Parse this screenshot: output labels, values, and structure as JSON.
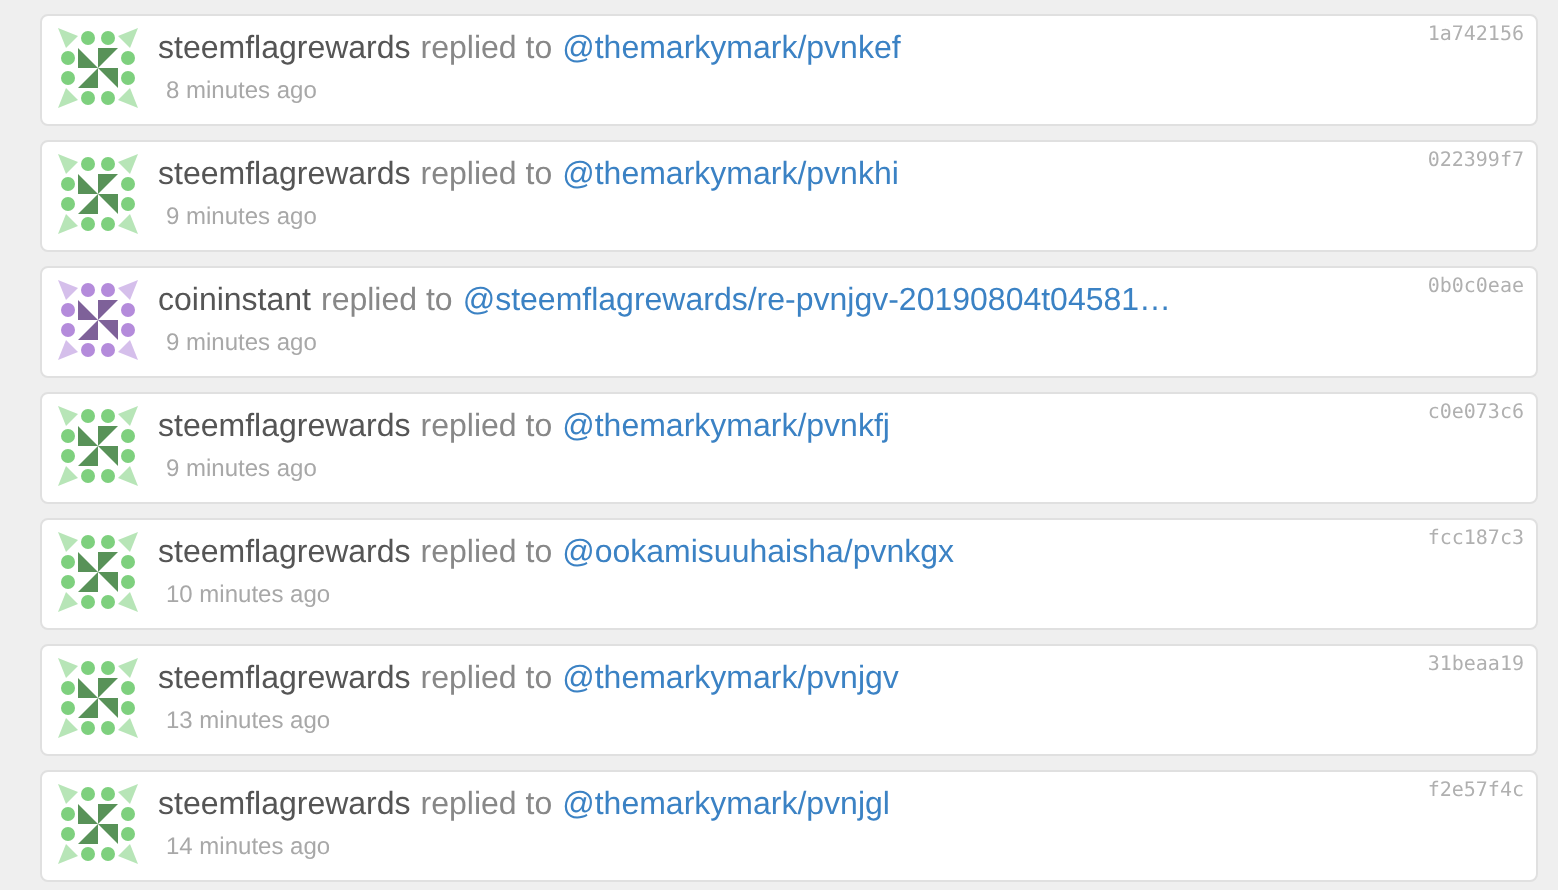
{
  "activities": [
    {
      "author": "steemflagrewards",
      "action": "replied to",
      "target": "@themarkymark/pvnkef",
      "time": "8 minutes ago",
      "hash": "1a742156",
      "avatar": {
        "color": "#7ed07e"
      }
    },
    {
      "author": "steemflagrewards",
      "action": "replied to",
      "target": "@themarkymark/pvnkhi",
      "time": "9 minutes ago",
      "hash": "022399f7",
      "avatar": {
        "color": "#7ed07e"
      }
    },
    {
      "author": "coininstant",
      "action": "replied to",
      "target": "@steemflagrewards/re-pvnjgv-20190804t04581…",
      "time": "9 minutes ago",
      "hash": "0b0c0eae",
      "avatar": {
        "color": "#b48bdb"
      }
    },
    {
      "author": "steemflagrewards",
      "action": "replied to",
      "target": "@themarkymark/pvnkfj",
      "time": "9 minutes ago",
      "hash": "c0e073c6",
      "avatar": {
        "color": "#7ed07e"
      }
    },
    {
      "author": "steemflagrewards",
      "action": "replied to",
      "target": "@ookamisuuhaisha/pvnkgx",
      "time": "10 minutes ago",
      "hash": "fcc187c3",
      "avatar": {
        "color": "#7ed07e"
      }
    },
    {
      "author": "steemflagrewards",
      "action": "replied to",
      "target": "@themarkymark/pvnjgv",
      "time": "13 minutes ago",
      "hash": "31beaa19",
      "avatar": {
        "color": "#7ed07e"
      }
    },
    {
      "author": "steemflagrewards",
      "action": "replied to",
      "target": "@themarkymark/pvnjgl",
      "time": "14 minutes ago",
      "hash": "f2e57f4c",
      "avatar": {
        "color": "#7ed07e"
      }
    }
  ]
}
